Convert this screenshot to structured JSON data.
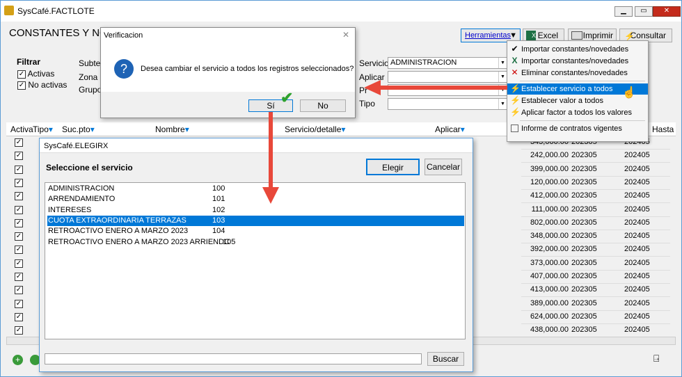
{
  "window": {
    "title": "SysCafé.FACTLOTE",
    "heading": "CONSTANTES Y NOV"
  },
  "toolbar": {
    "herramientas": "Herramientas",
    "excel": "Excel",
    "imprimir": "Imprimir",
    "consultar": "Consultar"
  },
  "filtrar": {
    "label": "Filtrar",
    "activas": "Activas",
    "no_activas": "No activas",
    "subter": "Subter",
    "zona": "Zona",
    "grupo": "Grupo"
  },
  "form": {
    "servicio_label": "Servicio",
    "servicio_value": "ADMINISTRACION",
    "aplicar_label": "Aplicar",
    "pr_label": "Pr",
    "tipo_label": "Tipo"
  },
  "grid": {
    "headers": [
      "Activa",
      "Tipo",
      "Suc.pto",
      "Nombre",
      "Servicio/detalle",
      "Aplicar",
      "Hasta"
    ],
    "rows": [
      [
        "343,000.00",
        "202305",
        "202405"
      ],
      [
        "242,000.00",
        "202305",
        "202405"
      ],
      [
        "399,000.00",
        "202305",
        "202405"
      ],
      [
        "120,000.00",
        "202305",
        "202405"
      ],
      [
        "412,000.00",
        "202305",
        "202405"
      ],
      [
        "111,000.00",
        "202305",
        "202405"
      ],
      [
        "802,000.00",
        "202305",
        "202405"
      ],
      [
        "348,000.00",
        "202305",
        "202405"
      ],
      [
        "392,000.00",
        "202305",
        "202405"
      ],
      [
        "373,000.00",
        "202305",
        "202405"
      ],
      [
        "407,000.00",
        "202305",
        "202405"
      ],
      [
        "413,000.00",
        "202305",
        "202405"
      ],
      [
        "389,000.00",
        "202305",
        "202405"
      ],
      [
        "624,000.00",
        "202305",
        "202405"
      ],
      [
        "438,000.00",
        "202305",
        "202405"
      ]
    ]
  },
  "menu": {
    "items": [
      "Importar constantes/novedades",
      "Importar constantes/novedades",
      "Eliminar constantes/novedades",
      "Establecer servicio a todos",
      "Establecer valor a todos",
      "Aplicar factor a todos los valores",
      "Informe de contratos vigentes"
    ]
  },
  "dialog": {
    "title": "Verificacion",
    "message": "Desea cambiar el servicio a todos los registros seleccionados?",
    "yes": "Sí",
    "no": "No"
  },
  "elegir": {
    "title": "SysCafé.ELEGIRX",
    "heading": "Seleccione el servicio",
    "elegir_btn": "Elegir",
    "cancelar_btn": "Cancelar",
    "buscar_btn": "Buscar",
    "items": [
      {
        "name": "ADMINISTRACION",
        "code": "100"
      },
      {
        "name": "ARRENDAMIENTO",
        "code": "101"
      },
      {
        "name": "INTERESES",
        "code": "102"
      },
      {
        "name": "CUOTA EXTRAORDINARIA TERRAZAS",
        "code": "103"
      },
      {
        "name": "RETROACTIVO ENERO A MARZO 2023",
        "code": "104"
      },
      {
        "name": "RETROACTIVO ENERO A MARZO 2023  ARRIENDC",
        "code": "105"
      }
    ]
  },
  "colors": {
    "accent": "#0078d7",
    "arrow": "#e8483a"
  }
}
